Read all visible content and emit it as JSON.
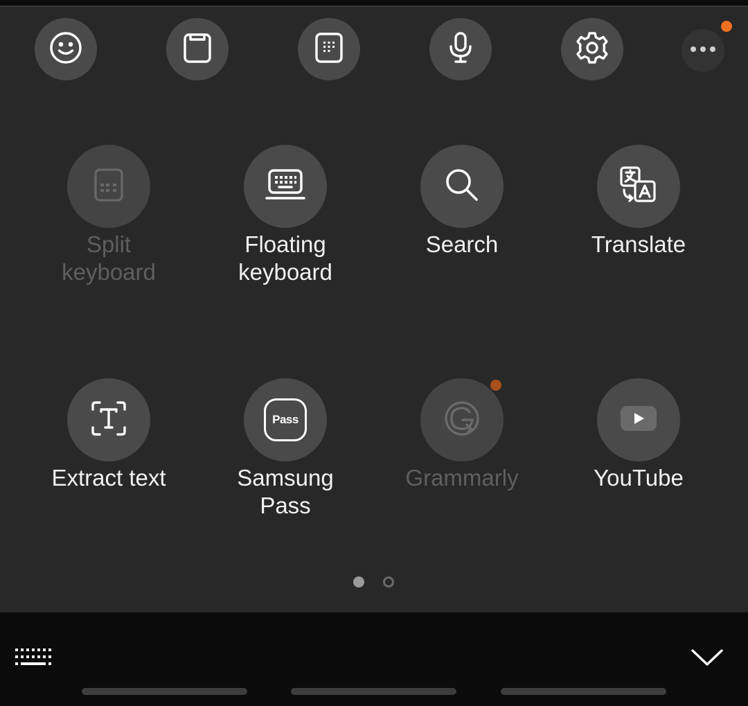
{
  "toolbar": {
    "items": [
      {
        "icon": "emoji-icon"
      },
      {
        "icon": "clipboard-icon"
      },
      {
        "icon": "keypad-icon"
      },
      {
        "icon": "microphone-icon"
      },
      {
        "icon": "gear-icon"
      }
    ],
    "more_icon": "more-dots-icon",
    "badge_color": "#f07121"
  },
  "tools": [
    {
      "label": "Split\nkeyboard",
      "icon": "split-keyboard-icon",
      "enabled": false
    },
    {
      "label": "Floating\nkeyboard",
      "icon": "floating-keyboard-icon",
      "enabled": true
    },
    {
      "label": "Search",
      "icon": "search-icon",
      "enabled": true
    },
    {
      "label": "Translate",
      "icon": "translate-icon",
      "enabled": true
    },
    {
      "label": "Extract text",
      "icon": "extract-text-icon",
      "enabled": true
    },
    {
      "label": "Samsung\nPass",
      "icon": "samsung-pass-icon",
      "icon_text": "Pass",
      "enabled": true
    },
    {
      "label": "Grammarly",
      "icon": "grammarly-icon",
      "enabled": false
    },
    {
      "label": "YouTube",
      "icon": "youtube-icon",
      "enabled": true
    }
  ],
  "pager": {
    "total": 2,
    "current": 1
  },
  "bottom_bar": {
    "keyboard_icon": "keyboard-icon",
    "collapse_icon": "chevron-down-icon"
  },
  "colors": {
    "panel_bg": "#282828",
    "button_bg": "#4a4a4a",
    "text": "#f1f1f1",
    "disabled_text": "#5f5f5f",
    "accent_badge": "#f07121"
  }
}
